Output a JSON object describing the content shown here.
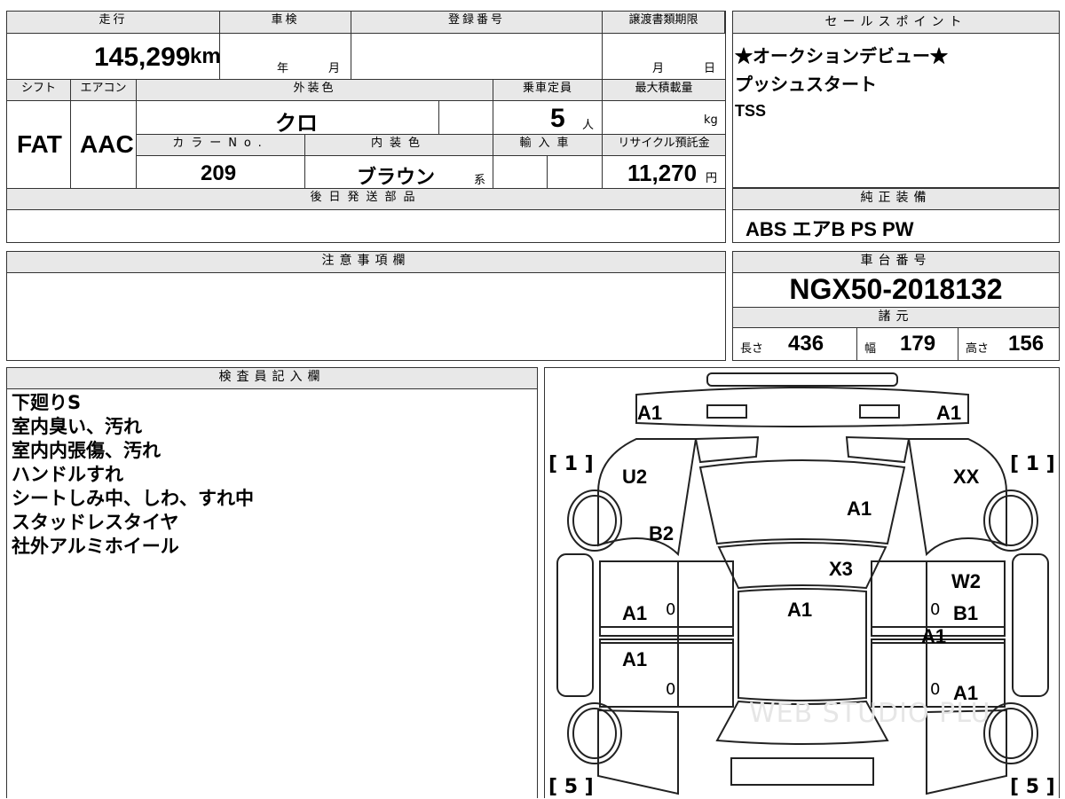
{
  "top": {
    "headers": {
      "mileage": "走行",
      "inspection": "車検",
      "registration_no": "登録番号",
      "transfer_deadline": "譲渡書類期限",
      "sales_points": "セールスポイント",
      "shift": "シフト",
      "aircon": "エアコン",
      "exterior_color": "外装色",
      "capacity": "乗車定員",
      "max_load": "最大積載量",
      "color_no": "カラーNo.",
      "interior_color": "内装色",
      "imported": "輸入車",
      "recycle_fee": "リサイクル預託金",
      "later_parts": "後日発送部品",
      "genuine_equipment": "純正装備",
      "notes": "注意事項欄",
      "chassis_no": "車台番号",
      "specs": "諸元",
      "inspector": "検査員記入欄"
    },
    "mileage_value": "145,299",
    "mileage_unit": "km",
    "year_label": "年",
    "month_label": "月",
    "deadline_month": "月",
    "deadline_day": "日",
    "shift_value": "FAT",
    "aircon_value": "AAC",
    "exterior_color_value": "クロ",
    "capacity_value": "5",
    "capacity_unit": "人",
    "max_load_unit": "kg",
    "color_no_value": "209",
    "interior_color_value": "ブラウン",
    "interior_suffix": "系",
    "recycle_value": "11,270",
    "recycle_unit": "円"
  },
  "sales_points": [
    "★オークションデビュー★",
    "プッシュスタート",
    "TSS"
  ],
  "genuine_equipment": "ABS エアB PS PW",
  "chassis_no": "NGX50-2018132",
  "specs": {
    "length_label": "長さ",
    "length": "436",
    "width_label": "幅",
    "width": "179",
    "height_label": "高さ",
    "height": "156"
  },
  "inspector_notes": [
    "下廻りS",
    "室内臭い、汚れ",
    "室内内張傷、汚れ",
    "ハンドルすれ",
    "シートしみ中、しわ、すれ中",
    "スタッドレスタイヤ",
    "社外アルミホイール"
  ],
  "diagram": {
    "bracket_tl": "[ 1 ]",
    "bracket_tr": "[ 1 ]",
    "bracket_bl": "[ 5 ]",
    "bracket_br": "[ 5 ]",
    "marks": {
      "front_left": "A1",
      "front_right": "A1",
      "fender_left": "U2",
      "fender_right": "XX",
      "pillar_left": "B2",
      "hood": "A1",
      "windshield": "X3",
      "door_right_front": "W2",
      "door_left_front": "A1",
      "roof": "A1",
      "door_right_front2": "B1",
      "sill_right": "A1",
      "door_left_rear": "A1",
      "door_right_rear": "A1",
      "zero1": "0",
      "zero2": "0",
      "zero3": "0",
      "zero4": "0"
    },
    "watermark": "WEB STUDIO PLU"
  }
}
